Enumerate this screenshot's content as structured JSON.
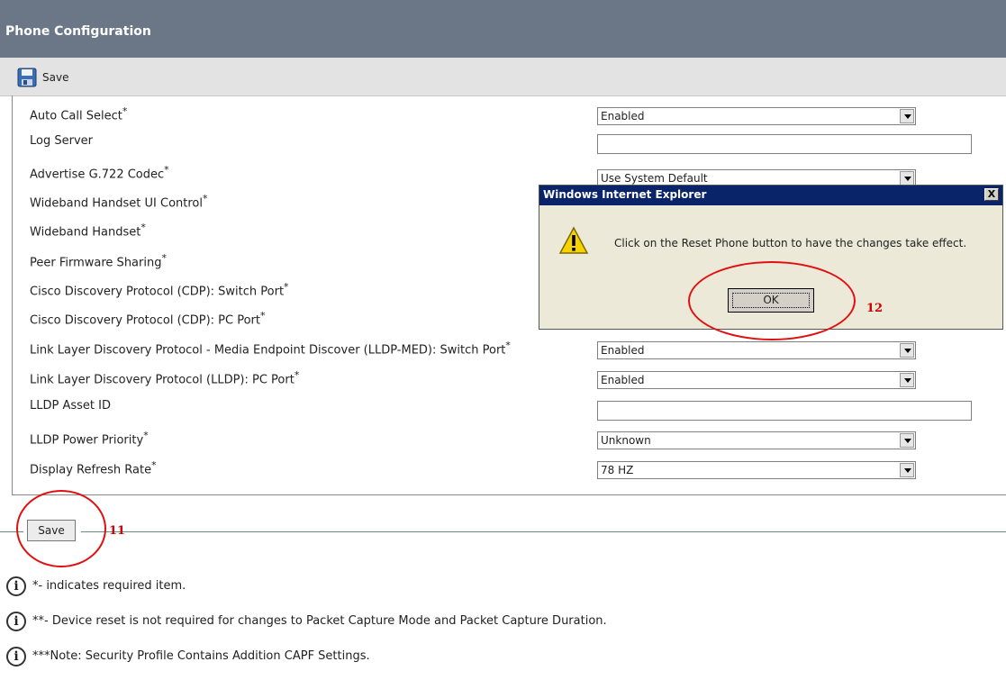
{
  "header": {
    "title": "Phone Configuration"
  },
  "toolbar": {
    "save_label": "Save"
  },
  "form": {
    "rows": [
      {
        "label": "Auto Call Select",
        "required": "*",
        "value": "Enabled"
      },
      {
        "label": "Log Server",
        "required": "",
        "value": ""
      },
      {
        "label": "Advertise G.722 Codec",
        "required": "*",
        "value": "Use System Default"
      },
      {
        "label": "Wideband Handset UI Control",
        "required": "*"
      },
      {
        "label": "Wideband Handset",
        "required": "*"
      },
      {
        "label": "Peer Firmware Sharing",
        "required": "*"
      },
      {
        "label": "Cisco Discovery Protocol (CDP): Switch Port",
        "required": "*"
      },
      {
        "label": "Cisco Discovery Protocol (CDP): PC Port",
        "required": "*"
      },
      {
        "label": "Link Layer Discovery Protocol - Media Endpoint Discover (LLDP-MED): Switch Port",
        "required": "*",
        "value": "Enabled"
      },
      {
        "label": "Link Layer Discovery Protocol (LLDP): PC Port",
        "required": "*",
        "value": "Enabled"
      },
      {
        "label": "LLDP Asset ID",
        "required": "",
        "value": ""
      },
      {
        "label": "LLDP Power Priority",
        "required": "*",
        "value": "Unknown"
      },
      {
        "label": "Display Refresh Rate",
        "required": "*",
        "value": "78 HZ"
      }
    ]
  },
  "footer": {
    "save_label": "Save",
    "annotation_save": "11",
    "annotation_ok": "12",
    "notes": [
      "*- indicates required item.",
      "**- Device reset is not required for changes to Packet Capture Mode and Packet Capture Duration.",
      "***Note: Security Profile Contains Addition CAPF Settings."
    ]
  },
  "dialog": {
    "title": "Windows Internet Explorer",
    "close_label": "X",
    "message": "Click on the Reset Phone button to have the changes take effect.",
    "ok_label": "OK"
  },
  "colors": {
    "header_bg": "#6b7687",
    "dialog_title_bg": "#0a246a",
    "annotation_red": "#e01010"
  },
  "icons": {
    "toolbar": "floppy-disk-icon",
    "notes": "info-icon",
    "dialog": "warning-icon"
  }
}
